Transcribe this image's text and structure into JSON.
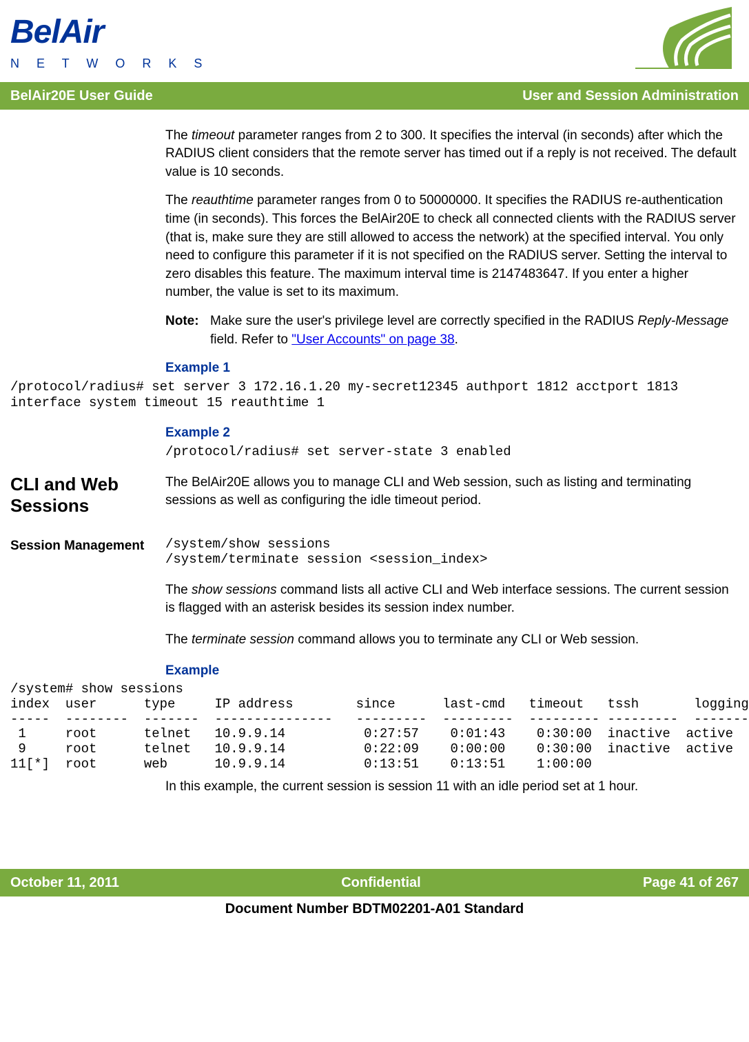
{
  "brand": {
    "name": "BelAir",
    "sub": "N  E  T  W  O  R  K  S"
  },
  "bar": {
    "left": "BelAir20E User Guide",
    "right": "User and Session Administration"
  },
  "para1_a": "The ",
  "para1_term": "timeout",
  "para1_b": " parameter ranges from 2 to 300. It specifies the interval (in seconds) after which the RADIUS client considers that the remote server has timed out if a reply is not received. The default value is 10 seconds.",
  "para2_a": "The ",
  "para2_term": "reauthtime",
  "para2_b": " parameter ranges from 0 to 50000000. It specifies the RADIUS re-authentication time (in seconds). This forces the BelAir20E to check all connected clients with the RADIUS server (that is, make sure they are still allowed to access the network) at the specified interval. You only need to configure this parameter if it is not specified on the RADIUS server. Setting the interval to zero disables this feature. The maximum interval time is 2147483647. If you enter a higher number, the value is set to its maximum.",
  "note_label": "Note:",
  "note_a": "Make sure the user's privilege level are correctly specified in the RADIUS ",
  "note_term": "Reply-Message",
  "note_b": " field. Refer to ",
  "note_link": "\"User Accounts\" on page 38",
  "note_c": ".",
  "example1_heading": "Example 1",
  "example1_code": "/protocol/radius# set server 3 172.16.1.20 my-secret12345 authport 1812 acctport 1813 interface system timeout 15 reauthtime 1",
  "example2_heading": "Example 2",
  "example2_code": "/protocol/radius# set server-state 3 enabled",
  "section_cli": "CLI and Web Sessions",
  "cli_para": "The BelAir20E allows you to manage CLI and Web session, such as listing and terminating sessions as well as configuring the idle timeout period.",
  "subsection_sm": "Session Management",
  "sm_code": "/system/show sessions\n/system/terminate session <session_index>",
  "sm_para1_a": "The ",
  "sm_para1_term": "show sessions",
  "sm_para1_b": " command lists all active CLI and Web interface sessions. The current session is flagged with an asterisk besides its session index number.",
  "sm_para2_a": "The ",
  "sm_para2_term": "terminate session",
  "sm_para2_b": " command allows you to terminate any CLI or Web session.",
  "example3_heading": "Example",
  "example3_code": "/system# show sessions\nindex  user      type     IP address        since      last-cmd   timeout   tssh       logging\n-----  --------  -------  ---------------   ---------  ---------  --------- ---------  ---------\n 1     root      telnet   10.9.9.14          0:27:57    0:01:43    0:30:00  inactive  active\n 9     root      telnet   10.9.9.14          0:22:09    0:00:00    0:30:00  inactive  active\n11[*]  root      web      10.9.9.14          0:13:51    0:13:51    1:00:00",
  "example3_para": "In this example, the current session is session 11 with an idle period set at 1 hour.",
  "footer": {
    "date": "October 11, 2011",
    "conf": "Confidential",
    "page": "Page 41 of 267",
    "doc": "Document Number BDTM02201-A01 Standard"
  }
}
